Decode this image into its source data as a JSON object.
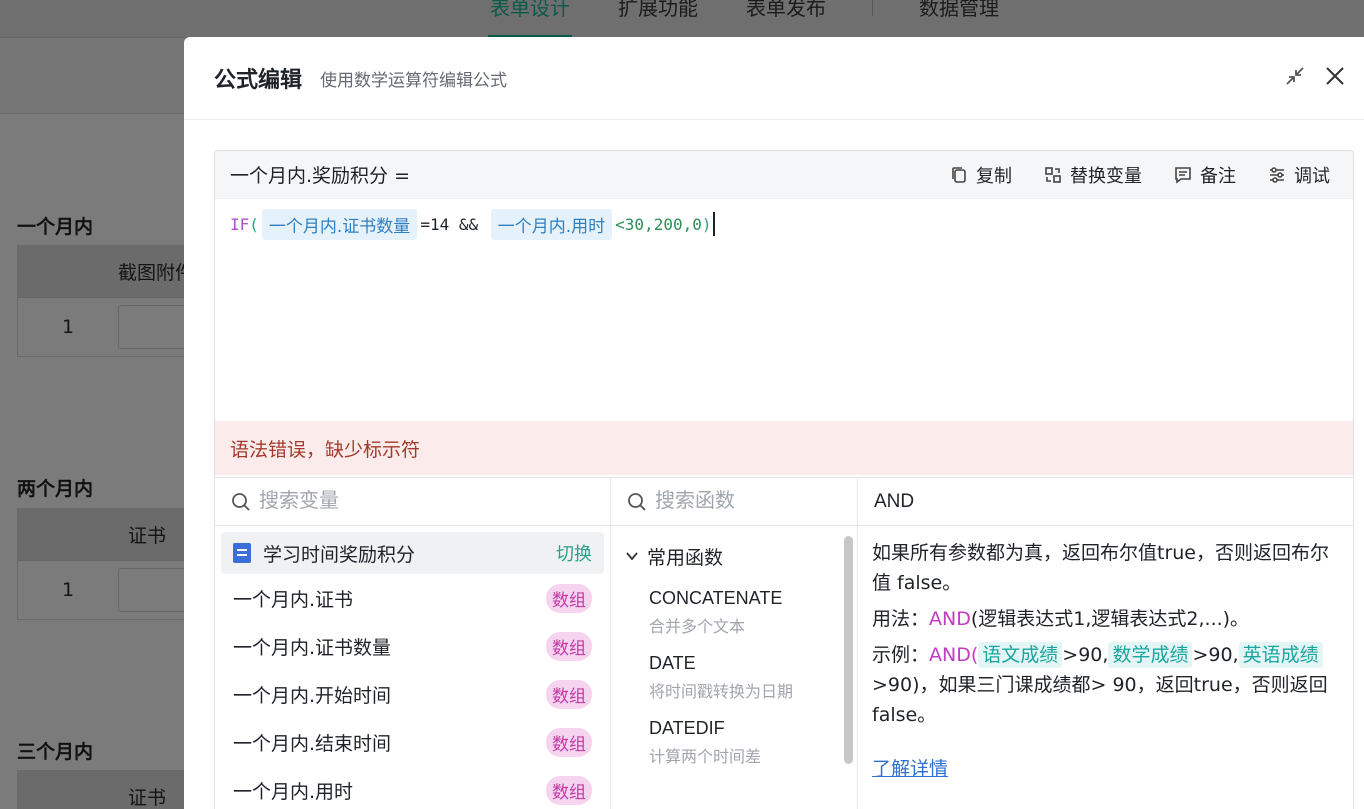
{
  "background": {
    "tabs": [
      "表单设计",
      "扩展功能",
      "表单发布",
      "数据管理"
    ],
    "sections": [
      {
        "title": "一个月内",
        "header": "截图附件",
        "row_index": "1"
      },
      {
        "title": "两个月内",
        "header": "证书",
        "row_index": "1"
      },
      {
        "title": "三个月内",
        "header": "证书"
      }
    ]
  },
  "modal": {
    "title": "公式编辑",
    "subtitle": "使用数学运算符编辑公式",
    "icons": [
      "collapse-icon",
      "close-icon"
    ]
  },
  "editor": {
    "field_label": "一个月内.奖励积分 =",
    "actions": {
      "copy": "复制",
      "replace": "替换变量",
      "note": "备注",
      "debug": "调试"
    },
    "formula": {
      "func": "IF",
      "open": "(",
      "var1": "一个月内.证书数量",
      "part1": "=14 && ",
      "var2": "一个月内.用时",
      "part2": "<30,200,0",
      "close": ")"
    },
    "error": "语法错误，缺少标示符"
  },
  "variables": {
    "search_placeholder": "搜索变量",
    "group_label": "学习时间奖励积分",
    "switch_label": "切换",
    "items": [
      {
        "label": "一个月内.证书",
        "badge": "数组"
      },
      {
        "label": "一个月内.证书数量",
        "badge": "数组"
      },
      {
        "label": "一个月内.开始时间",
        "badge": "数组"
      },
      {
        "label": "一个月内.结束时间",
        "badge": "数组"
      },
      {
        "label": "一个月内.用时",
        "badge": "数组"
      }
    ]
  },
  "functions": {
    "search_placeholder": "搜索函数",
    "group_label": "常用函数",
    "items": [
      {
        "name": "CONCATENATE",
        "desc": "合并多个文本"
      },
      {
        "name": "DATE",
        "desc": "将时间戳转换为日期"
      },
      {
        "name": "DATEDIF",
        "desc": "计算两个时间差"
      }
    ]
  },
  "doc": {
    "name": "AND",
    "desc": "如果所有参数都为真，返回布尔值true，否则返回布尔值 false。",
    "usage_label": "用法：",
    "usage_fn": "AND",
    "usage_rest": "(逻辑表达式1,逻辑表达式2,...)。",
    "example_label": "示例：",
    "example_fn": "AND(",
    "tag1": "语文成绩",
    "gt1": ">90,",
    "tag2": "数学成绩",
    "gt2": ">90,",
    "tag3": "英语成绩",
    "example_rest": ">90)，如果三门课成绩都> 90，返回true，否则返回false。",
    "link": "了解详情"
  }
}
